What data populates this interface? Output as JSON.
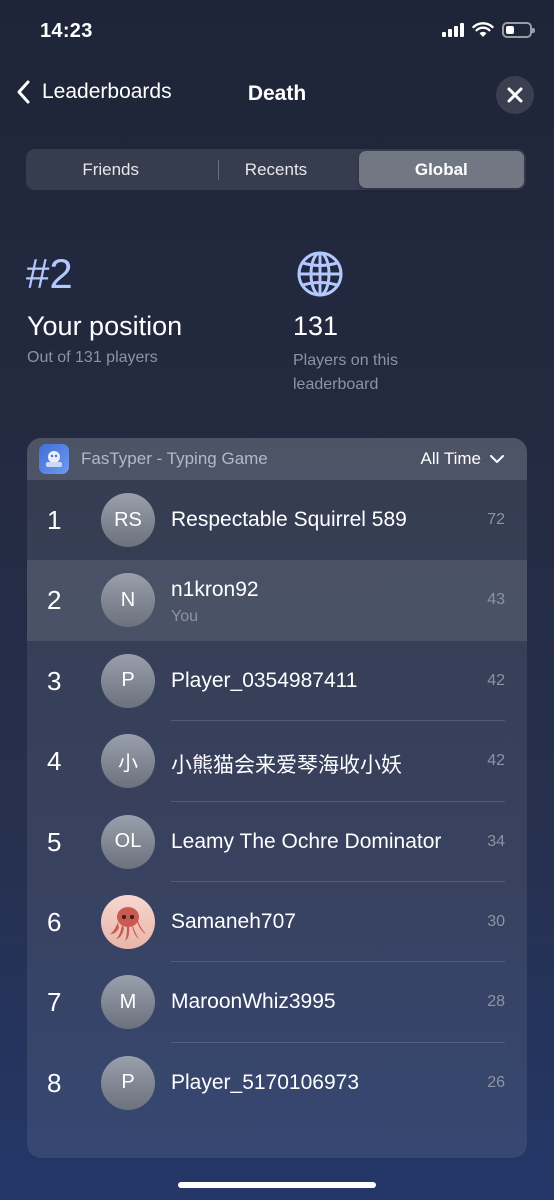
{
  "status": {
    "time": "14:23",
    "battery_level": 0.35
  },
  "nav": {
    "back_label": "Leaderboards",
    "title": "Death"
  },
  "tabs": [
    {
      "label": "Friends",
      "active": false
    },
    {
      "label": "Recents",
      "active": false
    },
    {
      "label": "Global",
      "active": true
    }
  ],
  "stats": {
    "rank": "#2",
    "position_label": "Your position",
    "position_sub": "Out of 131 players",
    "players_count": "131",
    "players_sub": "Players on this leaderboard",
    "globe_icon": "globe-icon"
  },
  "board": {
    "app_name": "FasTyper - Typing Game",
    "filter_label": "All Time",
    "rows": [
      {
        "rank": "1",
        "initials": "RS",
        "name": "Respectable Squirrel 589",
        "sub": "",
        "score": "72"
      },
      {
        "rank": "2",
        "initials": "N",
        "name": "n1kron92",
        "sub": "You",
        "score": "43"
      },
      {
        "rank": "3",
        "initials": "P",
        "name": "Player_0354987411",
        "sub": "",
        "score": "42"
      },
      {
        "rank": "4",
        "initials": "小",
        "name": "小熊猫会来爱琴海收小妖",
        "sub": "",
        "score": "42"
      },
      {
        "rank": "5",
        "initials": "OL",
        "name": "Leamy The Ochre Dominator",
        "sub": "",
        "score": "34"
      },
      {
        "rank": "6",
        "initials": "",
        "name": "Samaneh707",
        "sub": "",
        "score": "30"
      },
      {
        "rank": "7",
        "initials": "M",
        "name": "MaroonWhiz3995",
        "sub": "",
        "score": "28"
      },
      {
        "rank": "8",
        "initials": "P",
        "name": "Player_5170106973",
        "sub": "",
        "score": "26"
      }
    ]
  },
  "colors": {
    "accent": "#b3c8ff",
    "muted": "#8d93a3"
  }
}
